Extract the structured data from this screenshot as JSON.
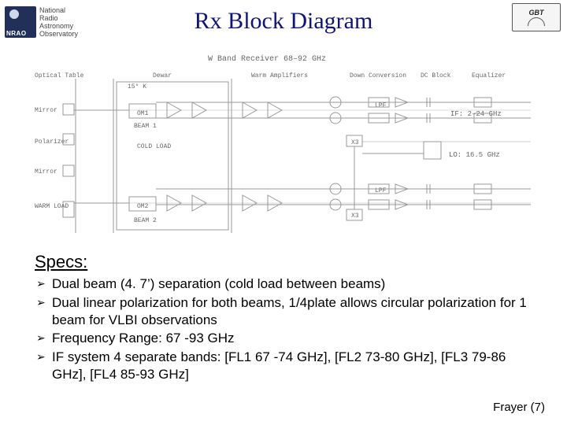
{
  "header": {
    "left_logo": {
      "badge_text": "NRAO",
      "words_line1": "National",
      "words_line2": "Radio",
      "words_line3": "Astronomy",
      "words_line4": "Observatory"
    },
    "right_logo_label": "GBT",
    "title": "Rx Block Diagram"
  },
  "diagram": {
    "caption": "W Band Receiver 68–92 GHz",
    "sections": {
      "optical_table": "Optical Table",
      "dewar": "Dewar",
      "warm_amps": "Warm Amplifiers",
      "down_conv": "Down Conversion",
      "dc_block": "DC Block",
      "equalizer": "Equalizer"
    },
    "labels": {
      "mirror1": "Mirror",
      "polarizer": "Polarizer",
      "mirror2": "Mirror",
      "warm_load": "WARM LOAD",
      "temp_15k": "15° K",
      "om1": "OM1",
      "om2": "OM2",
      "beam1": "BEAM 1",
      "beam2": "BEAM 2",
      "cold_load": "COLD LOAD",
      "if_range": "IF: 2–24 GHz",
      "lo": "LO: 16.5 GHz",
      "lpf": "LPF",
      "x3": "X3"
    }
  },
  "specs": {
    "heading": "Specs:",
    "items": [
      "Dual beam (4. 7’) separation (cold load between beams)",
      "Dual linear polarization for both beams, 1/4plate allows circular polarization for 1 beam for VLBI observations",
      "Frequency Range: 67 -93 GHz",
      "IF system 4 separate bands: [FL1 67 -74 GHz], [FL2 73-80 GHz], [FL3 79-86 GHz],  [FL4 85-93 GHz]"
    ]
  },
  "footer": {
    "text": "Frayer  (7)"
  }
}
